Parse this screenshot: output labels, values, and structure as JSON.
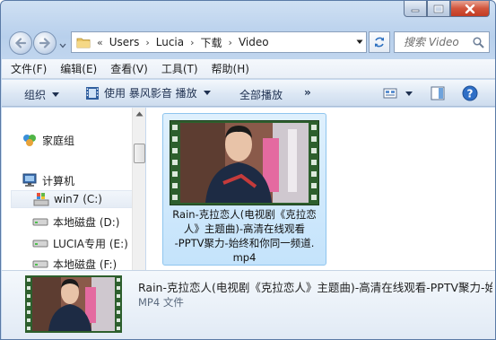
{
  "window": {
    "caption_buttons": [
      "minimize",
      "maximize",
      "close"
    ]
  },
  "address": {
    "overflow_marker": "«",
    "breadcrumb": [
      "Users",
      "Lucia",
      "下载",
      "Video"
    ],
    "separator": "›"
  },
  "search": {
    "placeholder": "搜索 Video"
  },
  "menu": [
    "文件(F)",
    "编辑(E)",
    "查看(V)",
    "工具(T)",
    "帮助(H)"
  ],
  "toolbar": {
    "organize": "组织",
    "play_with": "使用 暴风影音 播放",
    "play_all": "全部播放",
    "more": "»"
  },
  "nav": {
    "homegroup": "家庭组",
    "computer": "计算机",
    "drives": [
      "win7 (C:)",
      "本地磁盘 (D:)",
      "LUCIA专用 (E:)",
      "本地磁盘 (F:)"
    ]
  },
  "file": {
    "name": "Rain-克拉恋人(电视剧《克拉恋人》主题曲)-高清在线观看-PPTV聚力-始终和你同一频道.mp4",
    "name_lines": [
      "Rain-克拉恋人(电视剧《克拉恋",
      "人》主题曲)-高清在线观看",
      "-PPTV聚力-始终和你同一频道.",
      "mp4"
    ]
  },
  "details": {
    "name": "Rain-克拉恋人(电视剧《克拉恋人》主题曲)-高清在线观看-PPTV聚力-始终和你同一频道",
    "type": "MP4 文件"
  },
  "colors": {
    "frame": "#c6d9ef",
    "accent": "#1e3050",
    "selection": "#c4e3fb",
    "film_green": "#3a7d3a"
  }
}
